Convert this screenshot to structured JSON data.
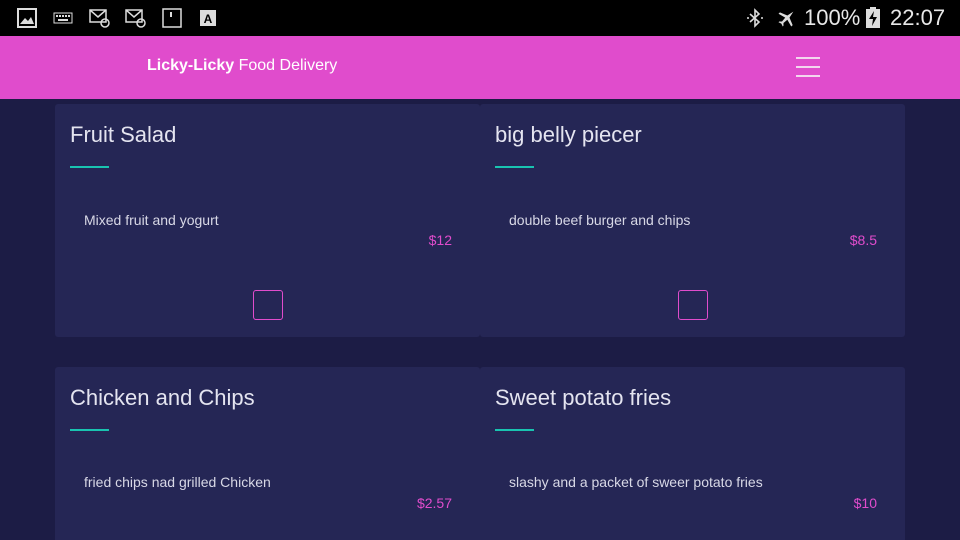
{
  "status_bar": {
    "left_icons": [
      "gallery-icon",
      "keyboard-icon",
      "mail-video-icon",
      "mail-at-icon",
      "sd-card-icon",
      "font-download-icon"
    ],
    "right_icons": [
      "bluetooth-icon",
      "airplane-mode-icon",
      "battery-charging-icon"
    ],
    "battery": "100%",
    "time": "22:07"
  },
  "app_bar": {
    "brand_bold": "Licky-Licky",
    "brand_rest": " Food Delivery",
    "menu_icon": "hamburger-menu-icon"
  },
  "colors": {
    "accent": "#e04ccc",
    "background": "#1c1c45",
    "card": "#252655",
    "rule": "#19c3b0"
  },
  "menu_items": [
    {
      "title": "Fruit Salad",
      "description": "Mixed fruit and yogurt",
      "price": "$12"
    },
    {
      "title": "big belly piecer",
      "description": "double beef burger and chips",
      "price": "$8.5"
    },
    {
      "title": "Chicken and Chips",
      "description": "fried chips nad grilled Chicken",
      "price": "$2.57"
    },
    {
      "title": "Sweet potato fries",
      "description": "slashy and a packet of sweer potato fries",
      "price": "$10"
    }
  ]
}
